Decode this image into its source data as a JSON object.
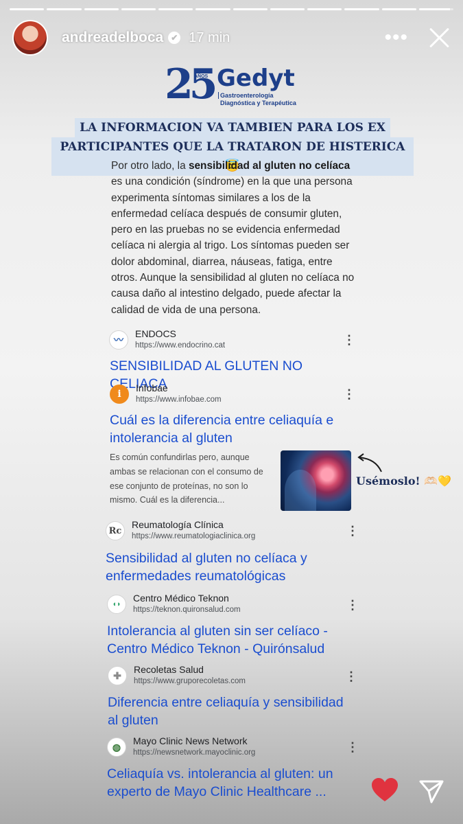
{
  "story": {
    "segments_total": 12,
    "segments_viewed": 11,
    "current_progress": 0.9
  },
  "header": {
    "username": "andreadelboca",
    "verified_icon": "✔",
    "time": "17 min",
    "more_label": "•••"
  },
  "logo": {
    "number": "25",
    "anos": "AÑOS",
    "name": "Gedyt",
    "subtitle_line1": "Gastroenterología",
    "subtitle_line2": "Diagnóstica y Terapéutica"
  },
  "banner": {
    "line1": "LA INFORMACION VA TAMBIEN PARA LOS  EX",
    "line2": "PARTICIPANTES QUE LA TRATARON DE HISTERICA 😇"
  },
  "body": {
    "intro": "Por otro lado, la ",
    "bold": "sensibilidad al gluten no celíaca",
    "rest": " es una condición (síndrome) en la que una persona experimenta síntomas similares a los de la enfermedad celíaca después de consumir gluten, pero en las pruebas no se evidencia enfermedad celíaca ni alergia al trigo. Los síntomas pueden ser dolor abdominal, diarrea, náuseas, fatiga, entre otros. Aunque la sensibilidad al gluten no celíaca no causa daño al intestino delgado, puede afectar la calidad de vida de una persona."
  },
  "results": [
    {
      "source": "ENDOCS",
      "url": "https://www.endocrino.cat",
      "favicon": "〰",
      "title": "SENSIBILIDAD AL GLUTEN NO CELIACA"
    },
    {
      "source": "Infobae",
      "url": "https://www.infobae.com",
      "favicon": "i",
      "title": "Cuál es la diferencia entre celiaquía e intolerancia al gluten"
    },
    {
      "source": "Reumatología Clínica",
      "url": "https://www.reumatologiaclinica.org",
      "favicon": "Rc",
      "title": "Sensibilidad al gluten no celíaca y enfermedades reumatológicas"
    },
    {
      "source": "Centro Médico Teknon",
      "url": "https://teknon.quironsalud.com",
      "favicon": "◖◗",
      "title": "Intolerancia al gluten sin ser celíaco - Centro Médico Teknon - Quirónsalud"
    },
    {
      "source": "Recoletas Salud",
      "url": "https://www.gruporecoletas.com",
      "favicon": "✚",
      "title": "Diferencia entre celiaquía y sensibilidad al gluten"
    },
    {
      "source": "Mayo Clinic News Network",
      "url": "https://newsnetwork.mayoclinic.org",
      "favicon": "◍",
      "title": "Celiaquía vs. intolerancia al gluten: un experto de Mayo Clinic Healthcare ..."
    }
  ],
  "snippet": "Es común confundirlas pero, aunque ambas se relacionan con el consumo de ese conjunto de proteínas, no son lo mismo. Cuál es la diferencia...",
  "annotation": {
    "text": "Usémoslo!",
    "emoji": " 🫶🏻💛"
  },
  "colors": {
    "link_blue": "#1a4dcf",
    "brand_blue": "#1d3f8a",
    "banner_bg": "#d6e2f0",
    "heart_red": "#e0333f"
  }
}
